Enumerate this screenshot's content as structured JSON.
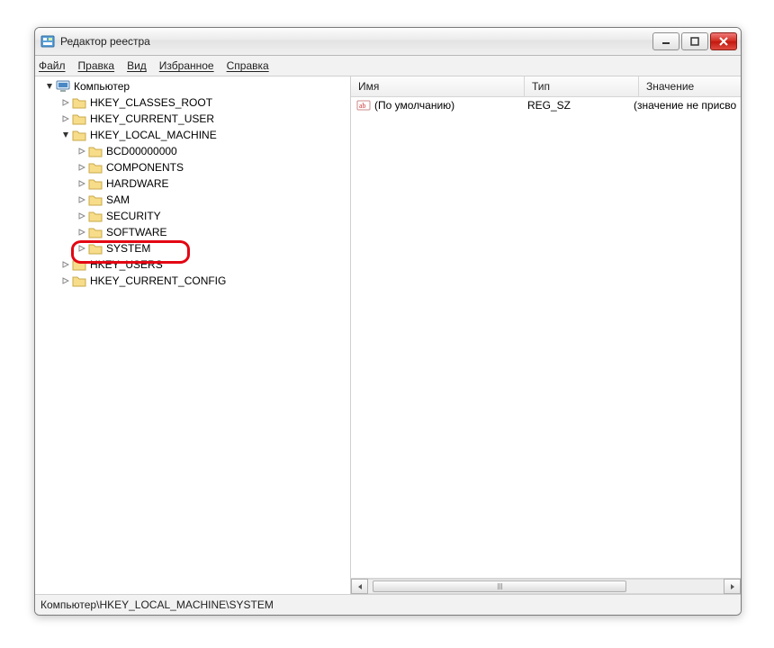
{
  "window": {
    "title": "Редактор реестра"
  },
  "menu": {
    "file": "Файл",
    "edit": "Правка",
    "view": "Вид",
    "favorites": "Избранное",
    "help": "Справка"
  },
  "tree": {
    "root": "Компьютер",
    "hives": {
      "classes_root": "HKEY_CLASSES_ROOT",
      "current_user": "HKEY_CURRENT_USER",
      "local_machine": "HKEY_LOCAL_MACHINE",
      "users": "HKEY_USERS",
      "current_config": "HKEY_CURRENT_CONFIG"
    },
    "hklm_children": [
      "BCD00000000",
      "COMPONENTS",
      "HARDWARE",
      "SAM",
      "SECURITY",
      "SOFTWARE",
      "SYSTEM"
    ],
    "highlighted": "SYSTEM"
  },
  "list": {
    "columns": {
      "name": "Имя",
      "type": "Тип",
      "value": "Значение"
    },
    "rows": [
      {
        "name": "(По умолчанию)",
        "type": "REG_SZ",
        "value": "(значение не присво"
      }
    ]
  },
  "status": {
    "path": "Компьютер\\HKEY_LOCAL_MACHINE\\SYSTEM"
  }
}
